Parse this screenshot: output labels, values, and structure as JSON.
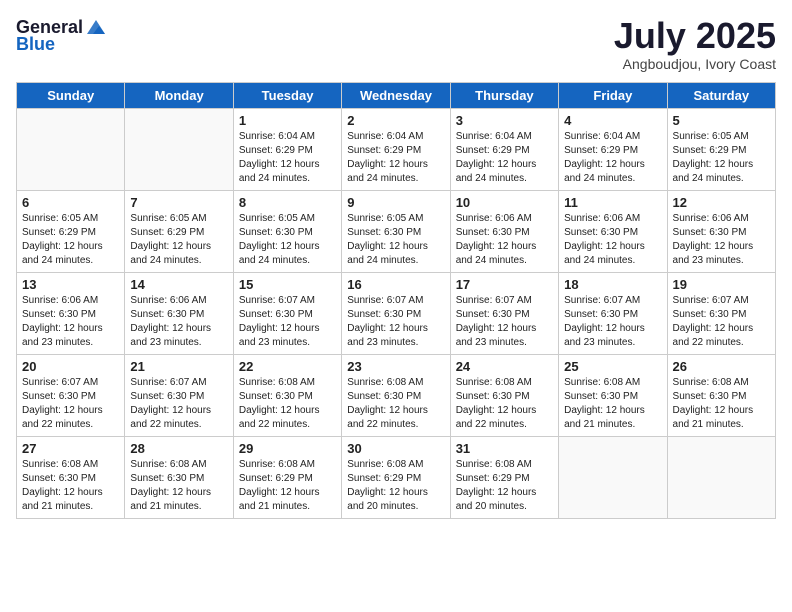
{
  "header": {
    "logo_general": "General",
    "logo_blue": "Blue",
    "month_year": "July 2025",
    "location": "Angboudjou, Ivory Coast"
  },
  "days_of_week": [
    "Sunday",
    "Monday",
    "Tuesday",
    "Wednesday",
    "Thursday",
    "Friday",
    "Saturday"
  ],
  "weeks": [
    [
      {
        "day": "",
        "info": ""
      },
      {
        "day": "",
        "info": ""
      },
      {
        "day": "1",
        "info": "Sunrise: 6:04 AM\nSunset: 6:29 PM\nDaylight: 12 hours\nand 24 minutes."
      },
      {
        "day": "2",
        "info": "Sunrise: 6:04 AM\nSunset: 6:29 PM\nDaylight: 12 hours\nand 24 minutes."
      },
      {
        "day": "3",
        "info": "Sunrise: 6:04 AM\nSunset: 6:29 PM\nDaylight: 12 hours\nand 24 minutes."
      },
      {
        "day": "4",
        "info": "Sunrise: 6:04 AM\nSunset: 6:29 PM\nDaylight: 12 hours\nand 24 minutes."
      },
      {
        "day": "5",
        "info": "Sunrise: 6:05 AM\nSunset: 6:29 PM\nDaylight: 12 hours\nand 24 minutes."
      }
    ],
    [
      {
        "day": "6",
        "info": "Sunrise: 6:05 AM\nSunset: 6:29 PM\nDaylight: 12 hours\nand 24 minutes."
      },
      {
        "day": "7",
        "info": "Sunrise: 6:05 AM\nSunset: 6:29 PM\nDaylight: 12 hours\nand 24 minutes."
      },
      {
        "day": "8",
        "info": "Sunrise: 6:05 AM\nSunset: 6:30 PM\nDaylight: 12 hours\nand 24 minutes."
      },
      {
        "day": "9",
        "info": "Sunrise: 6:05 AM\nSunset: 6:30 PM\nDaylight: 12 hours\nand 24 minutes."
      },
      {
        "day": "10",
        "info": "Sunrise: 6:06 AM\nSunset: 6:30 PM\nDaylight: 12 hours\nand 24 minutes."
      },
      {
        "day": "11",
        "info": "Sunrise: 6:06 AM\nSunset: 6:30 PM\nDaylight: 12 hours\nand 24 minutes."
      },
      {
        "day": "12",
        "info": "Sunrise: 6:06 AM\nSunset: 6:30 PM\nDaylight: 12 hours\nand 23 minutes."
      }
    ],
    [
      {
        "day": "13",
        "info": "Sunrise: 6:06 AM\nSunset: 6:30 PM\nDaylight: 12 hours\nand 23 minutes."
      },
      {
        "day": "14",
        "info": "Sunrise: 6:06 AM\nSunset: 6:30 PM\nDaylight: 12 hours\nand 23 minutes."
      },
      {
        "day": "15",
        "info": "Sunrise: 6:07 AM\nSunset: 6:30 PM\nDaylight: 12 hours\nand 23 minutes."
      },
      {
        "day": "16",
        "info": "Sunrise: 6:07 AM\nSunset: 6:30 PM\nDaylight: 12 hours\nand 23 minutes."
      },
      {
        "day": "17",
        "info": "Sunrise: 6:07 AM\nSunset: 6:30 PM\nDaylight: 12 hours\nand 23 minutes."
      },
      {
        "day": "18",
        "info": "Sunrise: 6:07 AM\nSunset: 6:30 PM\nDaylight: 12 hours\nand 23 minutes."
      },
      {
        "day": "19",
        "info": "Sunrise: 6:07 AM\nSunset: 6:30 PM\nDaylight: 12 hours\nand 22 minutes."
      }
    ],
    [
      {
        "day": "20",
        "info": "Sunrise: 6:07 AM\nSunset: 6:30 PM\nDaylight: 12 hours\nand 22 minutes."
      },
      {
        "day": "21",
        "info": "Sunrise: 6:07 AM\nSunset: 6:30 PM\nDaylight: 12 hours\nand 22 minutes."
      },
      {
        "day": "22",
        "info": "Sunrise: 6:08 AM\nSunset: 6:30 PM\nDaylight: 12 hours\nand 22 minutes."
      },
      {
        "day": "23",
        "info": "Sunrise: 6:08 AM\nSunset: 6:30 PM\nDaylight: 12 hours\nand 22 minutes."
      },
      {
        "day": "24",
        "info": "Sunrise: 6:08 AM\nSunset: 6:30 PM\nDaylight: 12 hours\nand 22 minutes."
      },
      {
        "day": "25",
        "info": "Sunrise: 6:08 AM\nSunset: 6:30 PM\nDaylight: 12 hours\nand 21 minutes."
      },
      {
        "day": "26",
        "info": "Sunrise: 6:08 AM\nSunset: 6:30 PM\nDaylight: 12 hours\nand 21 minutes."
      }
    ],
    [
      {
        "day": "27",
        "info": "Sunrise: 6:08 AM\nSunset: 6:30 PM\nDaylight: 12 hours\nand 21 minutes."
      },
      {
        "day": "28",
        "info": "Sunrise: 6:08 AM\nSunset: 6:30 PM\nDaylight: 12 hours\nand 21 minutes."
      },
      {
        "day": "29",
        "info": "Sunrise: 6:08 AM\nSunset: 6:29 PM\nDaylight: 12 hours\nand 21 minutes."
      },
      {
        "day": "30",
        "info": "Sunrise: 6:08 AM\nSunset: 6:29 PM\nDaylight: 12 hours\nand 20 minutes."
      },
      {
        "day": "31",
        "info": "Sunrise: 6:08 AM\nSunset: 6:29 PM\nDaylight: 12 hours\nand 20 minutes."
      },
      {
        "day": "",
        "info": ""
      },
      {
        "day": "",
        "info": ""
      }
    ]
  ]
}
